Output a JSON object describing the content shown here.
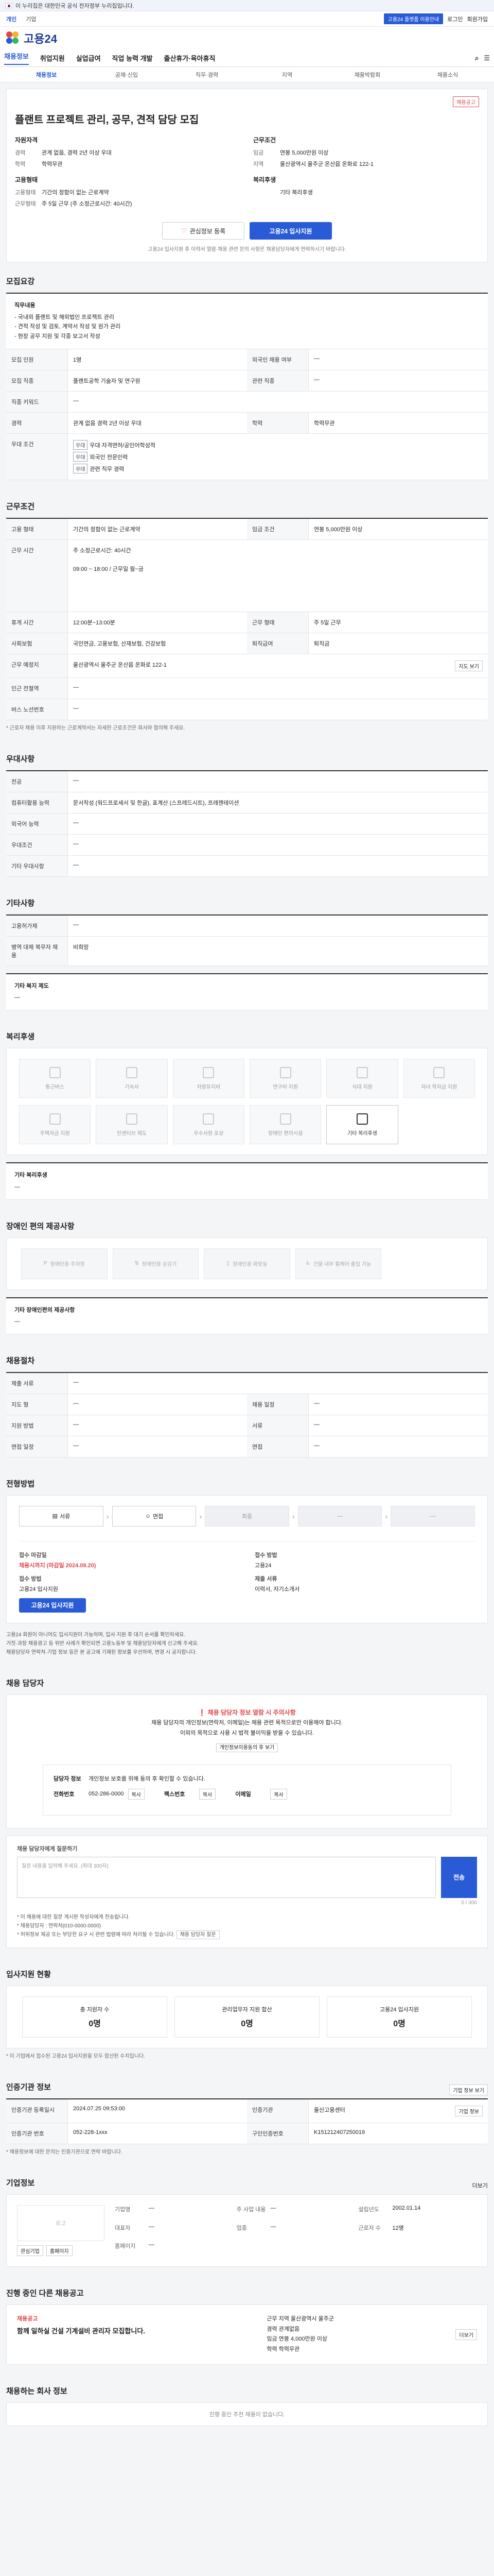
{
  "gov": {
    "text": "이 누리집은 대한민국 공식 전자정부 누리집입니다.",
    "more": ""
  },
  "top": {
    "links": [
      "개인",
      "기업"
    ],
    "right": [
      "고용24 플랫폼 이용안내",
      "로그인",
      "회원가입"
    ]
  },
  "logo": {
    "text": "고용24"
  },
  "gnb": {
    "items": [
      "채용정보",
      "취업지원",
      "실업급여",
      "직업 능력 개발",
      "출산휴가·육아휴직"
    ],
    "right": [
      "검색",
      "메뉴"
    ]
  },
  "subnav": [
    "채용정보",
    "공채·신입",
    "직무·경력",
    "지역",
    "채용박람회",
    "채용소식"
  ],
  "job": {
    "company": "",
    "badge": "채용공고",
    "title": "플랜트 프로젝트 관리, 공무, 견적 담당 모집",
    "left_head": "자원자격",
    "left": [
      {
        "k": "경력",
        "v": "관계 없음, 경력 2년 이상 우대"
      },
      {
        "k": "학력",
        "v": "학력무관"
      },
      {
        "k": "고용형태",
        "v": ""
      },
      {
        "k": "고용형태",
        "v": "기간의 정함이 없는 근로계약"
      },
      {
        "k": "근무형태",
        "v": "주 5일 근무 (주 소정근로시간: 40시간)"
      }
    ],
    "right_head": "근무조건",
    "right": [
      {
        "k": "임금",
        "v": "연봉 5,000만원 이상"
      },
      {
        "k": "지역",
        "v": "울산광역시 울주군 온산읍 온화로 122-1"
      },
      {
        "k": "복리후생",
        "v": ""
      },
      {
        "k": "",
        "v": "기타 복리후생"
      }
    ],
    "btn_like": "관심정보 등록",
    "btn_apply": "고용24 입사지원",
    "note": "고용24 입사지원 후 이력서 열람·채용 관련 문의 사항은 채용담당자에게 연락하시기 바랍니다."
  },
  "recruit": {
    "title": "모집요강",
    "duty_title": "직무내용",
    "duty": [
      "- 국내외 플랜트 및 해외법인 프로젝트 관리",
      "- 견적 작성 및 검토, 계약서 작성 및 원가 관리",
      "- 현장 공무 지원 및 각종 보고서 작성"
    ],
    "rows": [
      {
        "k": "모집 인원",
        "v": "1명",
        "k2": "외국인 채용 여부",
        "v2": "—"
      },
      {
        "k": "모집 직종",
        "v": "플랜트공학 기술자 및 연구원",
        "k2": "관련 직종",
        "v2": "—"
      },
      {
        "k": "직종 키워드",
        "v": "—",
        "k2": "",
        "v2": ""
      },
      {
        "k": "경력",
        "v": "관계 없음 경력 2년 이상 우대",
        "k2": "학력",
        "v2": "학력무관"
      },
      {
        "k": "우대 조건",
        "v": "",
        "k2": "",
        "v2": ""
      }
    ],
    "prefs": [
      "우대 자격면허/공인어학성적",
      "외국인 전문인력",
      "관련 직무 경력"
    ]
  },
  "work": {
    "title": "근무조건",
    "rows": [
      {
        "k": "고용 형태",
        "v": "기간의 정함이 없는 근로계약",
        "k2": "임금 조건",
        "v2": "연봉 5,000만원 이상"
      },
      {
        "k": "근무 시간",
        "v": "주 소정근로시간: 40시간",
        "k2": "",
        "v2": ""
      },
      {
        "k": "근무 시간2",
        "v": "09:00 ~ 18:00 / 근무일 월~금",
        "k2": "",
        "v2": ""
      },
      {
        "k": "휴게 시간",
        "v": "12:00분~13:00분",
        "k2": "근무 형태",
        "v2": "주 5일 근무"
      },
      {
        "k": "사회보험",
        "v": "국민연금, 고용보험, 산재보험, 건강보험",
        "k2": "퇴직급여",
        "v2": "퇴직금"
      },
      {
        "k": "근무 예정지",
        "v": "울산광역시 울주군 온산읍 온화로 122-1",
        "k2": "",
        "v2": ""
      },
      {
        "k": "인근 전철역",
        "v": "—",
        "k2": "",
        "v2": ""
      },
      {
        "k": "버스 노선번호",
        "v": "—",
        "k2": "",
        "v2": ""
      }
    ],
    "btn_map": "지도 보기",
    "note": "* 근로자 채용 이후 지원하는 근로계약서는 자세한 근로조건은 회사와 협의해 주세요."
  },
  "etc": {
    "title": "우대사항",
    "rows": [
      {
        "k": "전공",
        "v": "—"
      },
      {
        "k": "컴퓨터활용 능력",
        "v": "문서작성 (워드프로세서 및 한글), 표계산 (스프레드시트), 프레젠테이션"
      },
      {
        "k": "외국어 능력",
        "v": "—"
      },
      {
        "k": "우대조건",
        "v": "—"
      },
      {
        "k": "기타 우대사항",
        "v": "—"
      }
    ]
  },
  "other": {
    "title": "기타사항",
    "rows": [
      {
        "k": "고용허가제",
        "v": "—"
      },
      {
        "k": "병역 대체 복무자 채용",
        "v": "비희망"
      }
    ],
    "extra_title": "기타 복지 제도",
    "extra": "—"
  },
  "welfare": {
    "title": "복리후생",
    "items": [
      {
        "name": "통근버스",
        "on": false
      },
      {
        "name": "기숙사",
        "on": false
      },
      {
        "name": "차량유지비",
        "on": false
      },
      {
        "name": "연구비 지원",
        "on": false
      },
      {
        "name": "식대 지원",
        "on": false
      },
      {
        "name": "자녀 학자금 지원",
        "on": false
      },
      {
        "name": "주택자금 지원",
        "on": false
      },
      {
        "name": "인센티브 제도",
        "on": false
      },
      {
        "name": "우수사원 포상",
        "on": false
      },
      {
        "name": "장애인 편의시설",
        "on": false
      },
      {
        "name": "기타 복리후생",
        "on": true
      }
    ],
    "extra_title": "기타 복리후생",
    "extra": "—"
  },
  "disabled": {
    "title": "장애인 편의 제공사항",
    "items": [
      "장애인용 주차장",
      "장애인용 승강기",
      "장애인용 화장실",
      "건물 내부 휠체어 출입 가능",
      "—"
    ],
    "extra_title": "기타 장애인편의 제공사항",
    "extra": "—"
  },
  "select": {
    "title": "채용절차",
    "rows": [
      {
        "k": "제출 서류",
        "v": "—",
        "k2": "",
        "v2": ""
      },
      {
        "k": "지도 형",
        "v": "—",
        "k2": "채용 일정",
        "v2": "—"
      },
      {
        "k": "지원 방법",
        "v": "—",
        "k2": "서류",
        "v2": "—"
      },
      {
        "k": "면접 일정",
        "v": "—",
        "k2": "면접",
        "v2": "—"
      }
    ]
  },
  "process": {
    "title": "전형방법",
    "steps": [
      {
        "label": "서류",
        "gray": false
      },
      {
        "label": "면접",
        "gray": false
      },
      {
        "label": "최종",
        "gray": true
      },
      {
        "label": "—",
        "gray": true
      },
      {
        "label": "—",
        "gray": true
      }
    ],
    "left_lab": "접수 마감일",
    "left_val": "채용시까지 (마감일 2024.09.20)",
    "left_lab2": "접수 방법",
    "left_val2": "고용24 입사지원",
    "right_lab": "접수 방법",
    "right_val": "고용24",
    "right_lab2": "제출 서류",
    "right_val2": "이력서, 자기소개서",
    "apply_btn": "고용24 입사지원",
    "warn": [
      "고용24 회원이 아니어도 입사지원이 가능하며, 입사 지원 후 대기 순서를 확인하세요.",
      "거짓·과장 채용광고 등 위반 사례가 확인되면 고용노동부 및 채용담당자에게 신고해 주세요.",
      "채용담당자 연락처·기업 정보 등은 본 공고에 기재된 정보를 우선하며, 변경 시 공지합니다."
    ]
  },
  "manager": {
    "title": "채용 담당자",
    "w1": "채용 담당자 정보 열람 시 주의사항",
    "w2": "채용 담당자의 개인정보(연락처, 이메일)는 채용 관련 목적으로만 이용해야 합니다.",
    "w3": "이외의 목적으로 사용 시 법적 불이익을 받을 수 있습니다.",
    "btn": "개인정보이용동의 후 보기",
    "name_k": "담당자 정보",
    "name_v": "개인정보 보호를 위해 동의 후 확인할 수 있습니다.",
    "tel_k": "전화번호",
    "tel_v": "052-286-0000",
    "fax_k": "팩스번호",
    "email_k": "이메일",
    "copy": "복사",
    "qa_title": "채용 담당자에게 질문하기",
    "qa_placeholder": "질문 내용을 입력해 주세요. (최대 300자)",
    "qa_btn": "전송",
    "qa_count": "0 / 300",
    "qa_notes": [
      "* 이 채용에 대한 질문 게시판 작성자에게 전송됩니다.",
      "* 채용담당자 : 연락처(010-0000-0000)",
      "* 허위정보 제공 또는 부당한 요구 시 관련 법령에 따라 처리될 수 있습니다."
    ],
    "qa_link": "채용 담당자 질문"
  },
  "applicants": {
    "title": "입사지원 현황",
    "items": [
      {
        "label": "총 지원자 수",
        "val": "0명"
      },
      {
        "label": "관리업무자 지원 합산",
        "val": "0명"
      },
      {
        "label": "고용24 입사지원",
        "val": "0명"
      }
    ],
    "note": "* 이 기업에서 접수된 고용24 입사지원을 모두 합산된 수치입니다."
  },
  "agency": {
    "title": "인증기관 정보",
    "btn": "기업 정보 보기",
    "rows": [
      {
        "k": "인증기관 등록일시",
        "v": "2024.07.25 09:53:00",
        "k2": "인증기관",
        "v2": "울산고용센터",
        "btn": "기업 정보"
      },
      {
        "k": "인증기관 번호",
        "v": "052-228-1xxx",
        "k2": "구인인증번호",
        "v2": "K151212407250019"
      }
    ],
    "note": "* 채용정보에 대한 문의는 인증기관으로 연락 바랍니다."
  },
  "corp": {
    "title": "기업정보",
    "more": "더보기",
    "logo": "로고",
    "btns": [
      "관심기업",
      "홈페이지"
    ],
    "info": [
      {
        "k": "기업명",
        "v": "—"
      },
      {
        "k": "주 사업 내용",
        "v": "—"
      },
      {
        "k": "설립년도",
        "v": "2002.01.14"
      },
      {
        "k": "대표자",
        "v": "—"
      },
      {
        "k": "업종",
        "v": "—"
      },
      {
        "k": "근로자 수",
        "v": "12명"
      },
      {
        "k": "홈페이지",
        "v": "—"
      },
      {
        "k": "",
        "v": ""
      },
      {
        "k": "",
        "v": ""
      }
    ]
  },
  "more_jobs": {
    "title": "진행 중인 다른 채용공고",
    "left_title": "채용공고",
    "left_job": "함께 일하실 건설 기계설비 관리자 모집합니다.",
    "right": [
      "근무 지역 울산광역시 울주군",
      "경력 관계없음",
      "임금 연봉 4,000만원 이상",
      "학력 학력무관"
    ],
    "btn": "더보기"
  },
  "bottom": {
    "title": "채용하는 회사 정보",
    "text": "진행 중인 추천 채용이 없습니다."
  }
}
